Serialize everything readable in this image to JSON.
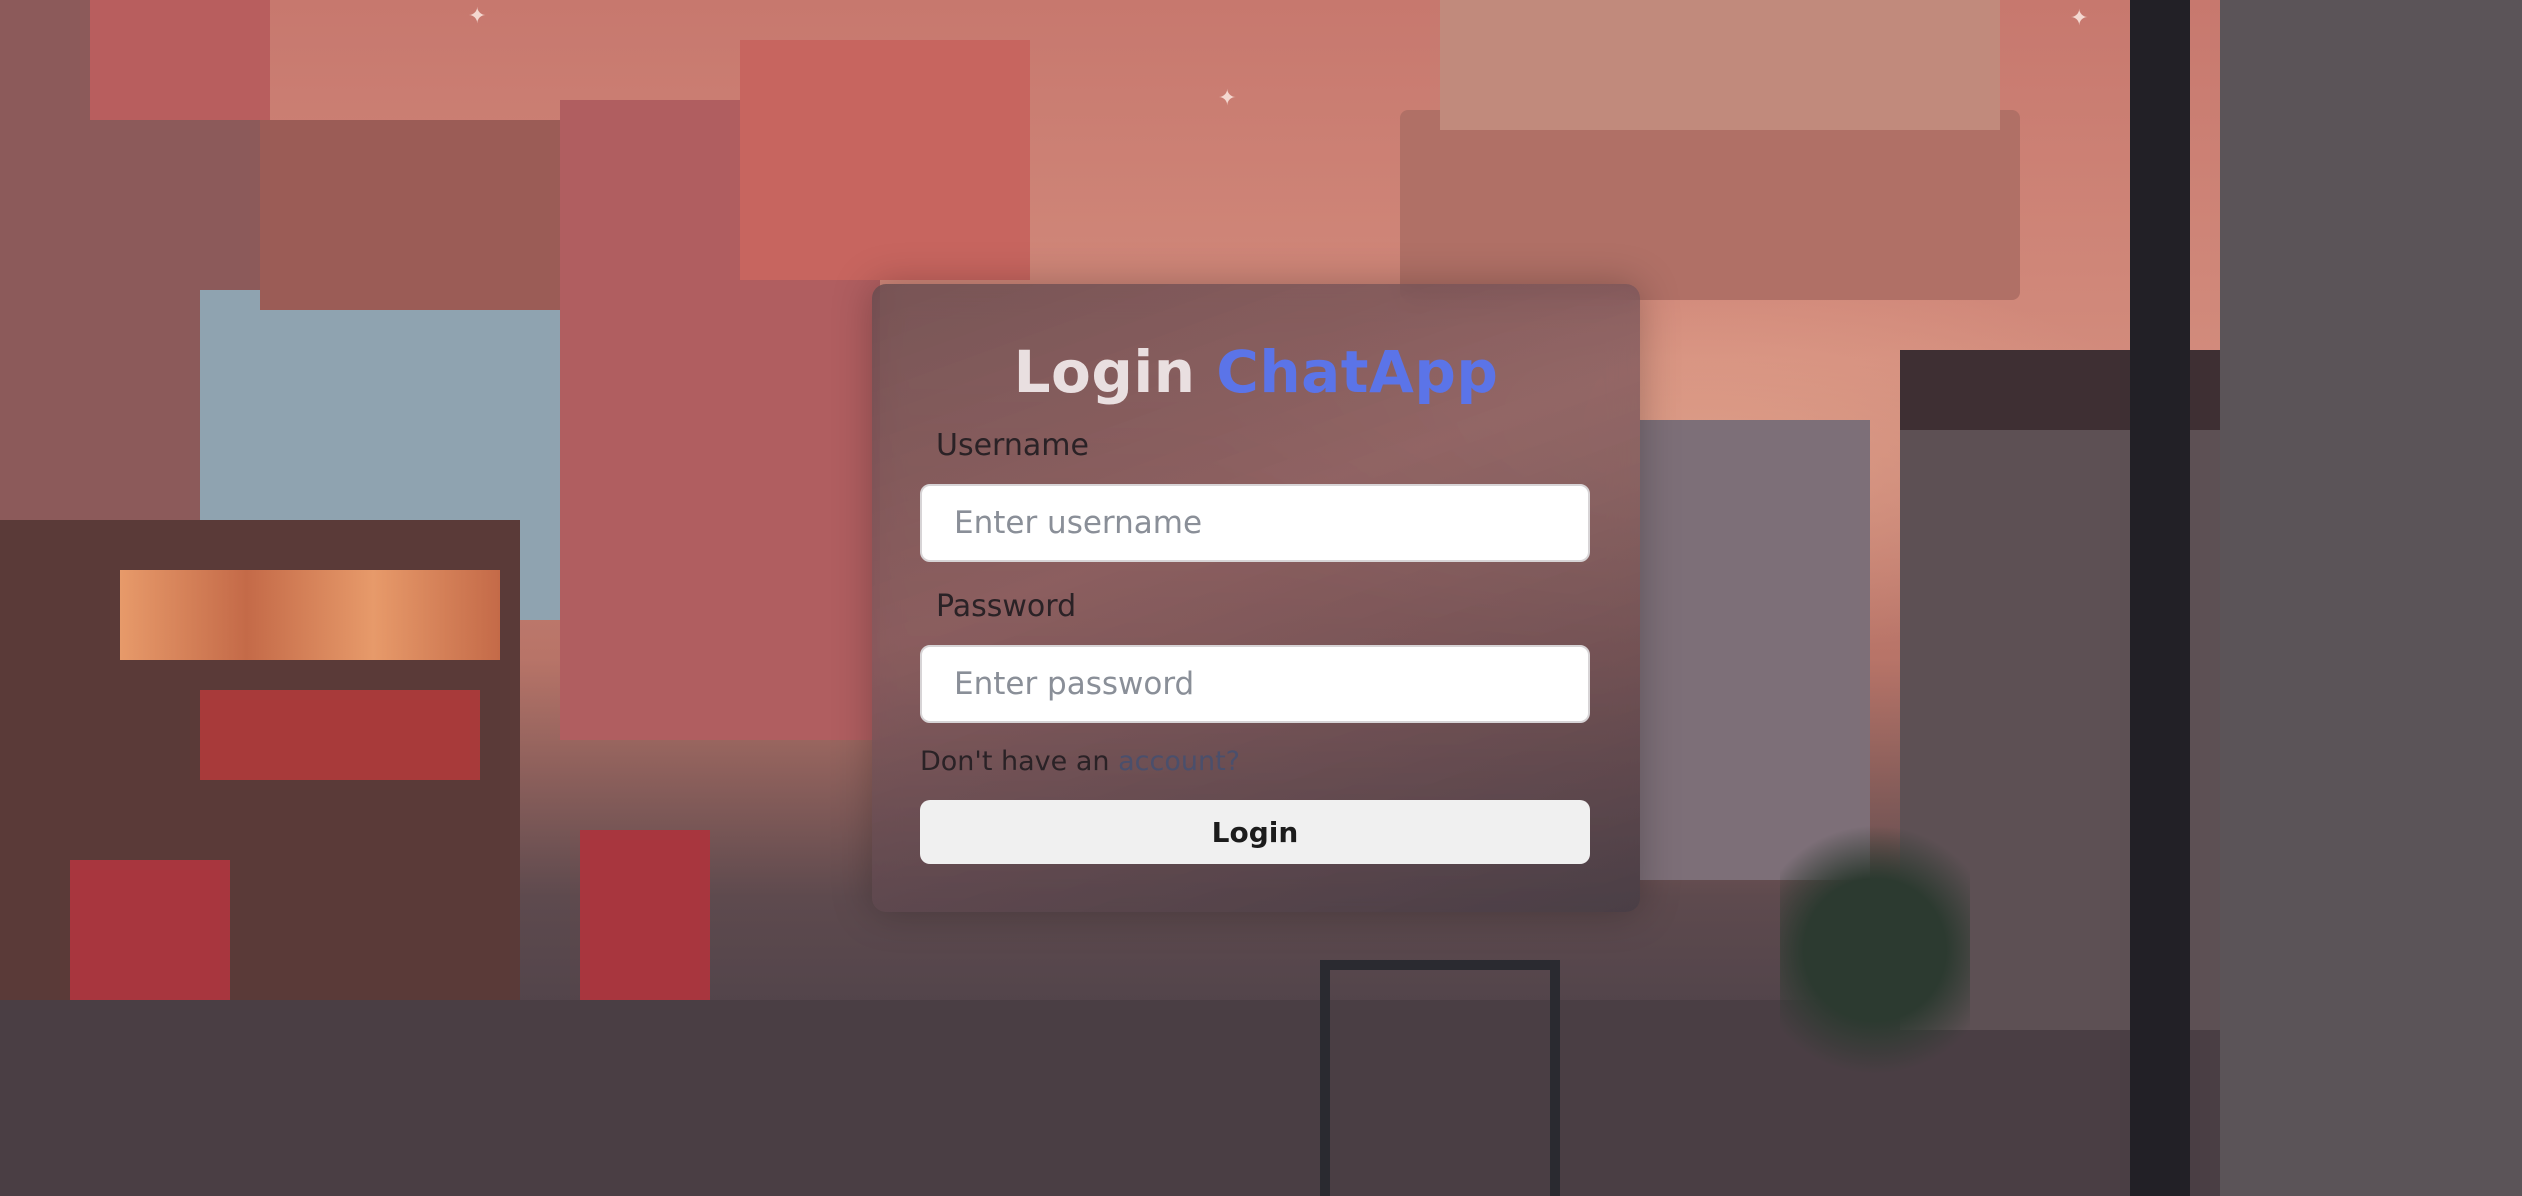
{
  "login_form": {
    "title_prefix": "Login",
    "title_brand": "ChatApp",
    "username_label": "Username",
    "username_placeholder": "Enter username",
    "password_label": "Password",
    "password_placeholder": "Enter password",
    "signup_prompt": "Don't have an ",
    "signup_link": "account?",
    "login_button": "Login"
  },
  "colors": {
    "brand": "#5b74e8",
    "card_tint": "#6e5257",
    "button_bg": "#f0f0f0"
  }
}
